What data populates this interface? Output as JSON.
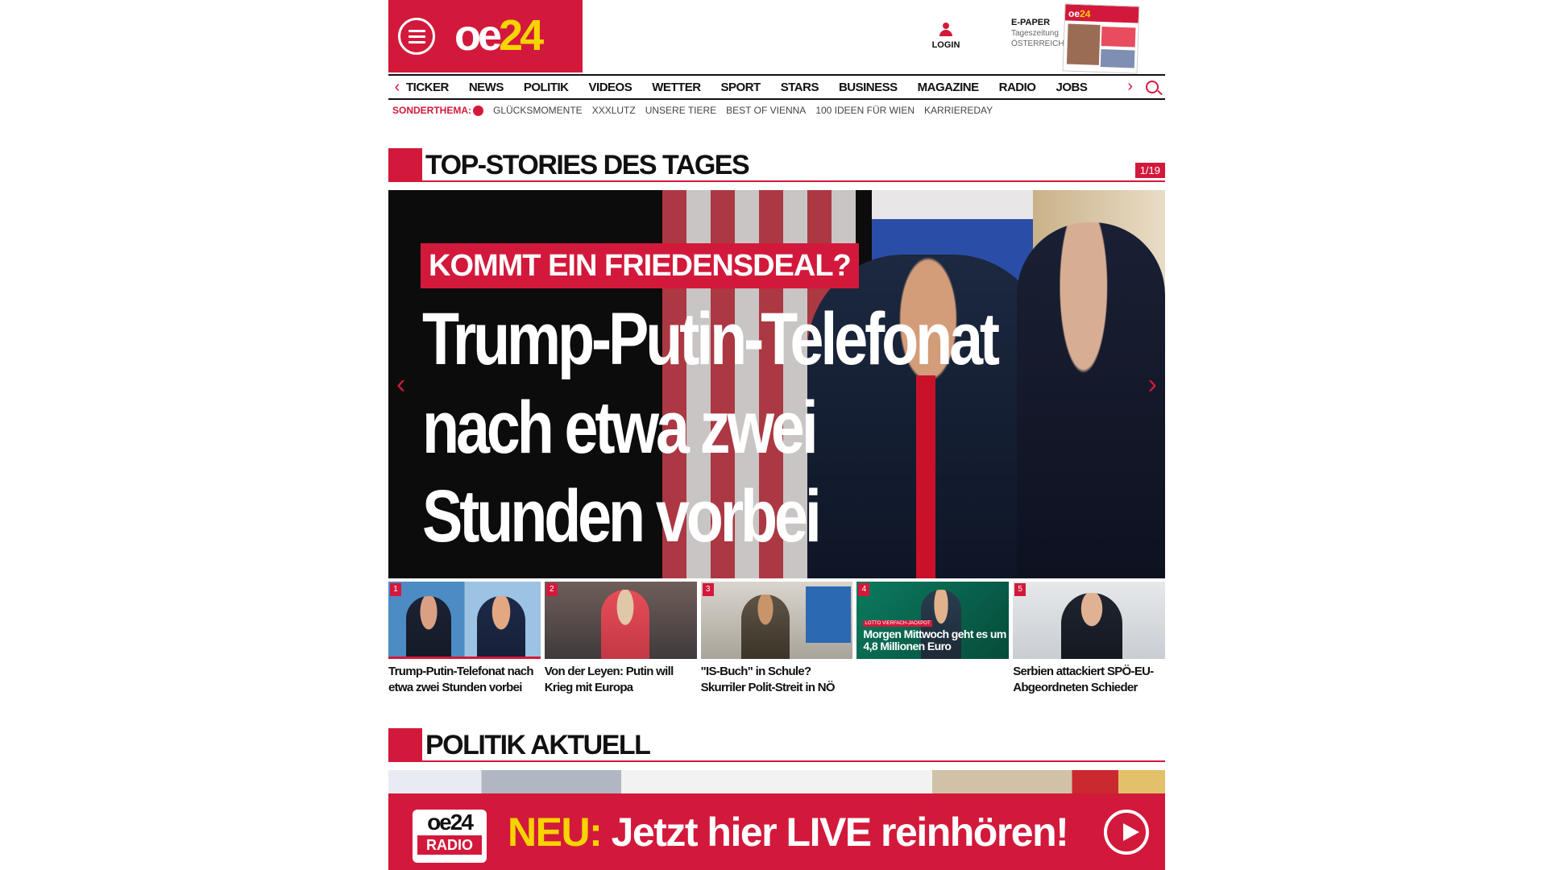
{
  "header": {
    "logo_oe": "oe",
    "logo_24": "24",
    "login_label": "LOGIN",
    "epaper_title": "E-PAPER",
    "epaper_sub1": "Tageszeitung",
    "epaper_sub2": "ÖSTERREICH",
    "paper_logo_oe": "oe",
    "paper_logo_24": "24"
  },
  "nav": {
    "items": [
      "TICKER",
      "NEWS",
      "POLITIK",
      "VIDEOS",
      "WETTER",
      "SPORT",
      "STARS",
      "BUSINESS",
      "MAGAZINE",
      "RADIO",
      "JOBS"
    ]
  },
  "subnav": {
    "sonderthema": "SONDERTHEMA:",
    "items": [
      "GLÜCKSMOMENTE",
      "XXXLUTZ",
      "UNSERE TIERE",
      "BEST OF VIENNA",
      "100 IDEEN FÜR WIEN",
      "KARRIEREDAY"
    ]
  },
  "topstories": {
    "title": "TOP-STORIES DES TAGES",
    "counter": "1/19"
  },
  "hero": {
    "kicker": "KOMMT EIN FRIEDENSDEAL?",
    "headline": "Trump-Putin-Telefonat nach etwa zwei Stunden vorbei"
  },
  "teasers": [
    {
      "num": "1",
      "caption": "Trump-Putin-Telefonat nach etwa zwei Stunden vorbei"
    },
    {
      "num": "2",
      "caption": "Von der Leyen: Putin will Krieg mit Europa"
    },
    {
      "num": "3",
      "caption": "\"IS-Buch\" in Schule? Skurriler Polit-Streit in NÖ"
    },
    {
      "num": "4",
      "caption": "Morgen Mittwoch geht es um 4,8 Millionen Euro",
      "image_label": "LOTTO VIERFACH-JACKPOT"
    },
    {
      "num": "5",
      "caption": "Serbien attackiert SPÖ-EU-Abgeordneten Schieder"
    }
  ],
  "politik": {
    "title": "POLITIK AKTUELL"
  },
  "radio_banner": {
    "logo_oe": "oe",
    "logo_24": "24",
    "logo_radio": "RADIO",
    "neu": "NEU:",
    "text": "Jetzt hier LIVE reinhören!"
  },
  "colors": {
    "brand_red": "#d3193b",
    "brand_yellow": "#f6d400"
  }
}
